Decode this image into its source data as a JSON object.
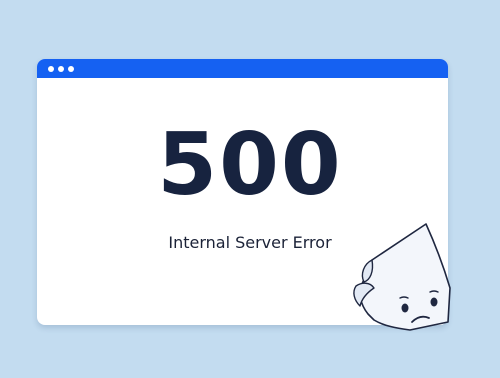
{
  "window": {
    "titlebar_color": "#1561f2",
    "titlebar_dots": [
      "dot",
      "dot",
      "dot"
    ]
  },
  "error": {
    "code": "500",
    "message": "Internal Server Error"
  },
  "illustration": {
    "icon": "sad-page-icon"
  }
}
